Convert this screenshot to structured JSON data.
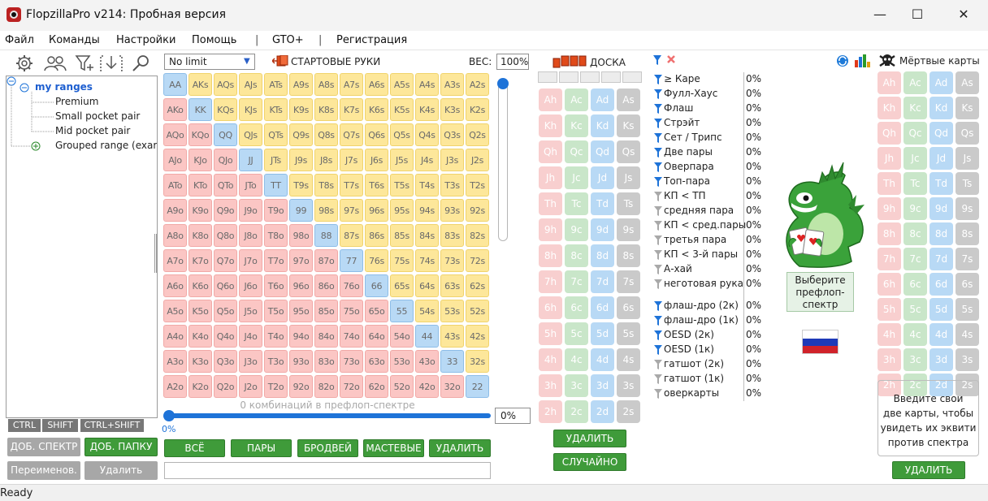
{
  "window": {
    "title": "FlopzillaPro v214: Пробная версия",
    "minimize": "—",
    "maximize": "☐",
    "close": "✕"
  },
  "menu": [
    "Файл",
    "Команды",
    "Настройки",
    "Помощь",
    "|",
    "GTO+",
    "|",
    "Регистрация"
  ],
  "tree": {
    "root": "my ranges",
    "items": [
      "Premium",
      "Small pocket pair",
      "Mid pocket pair"
    ],
    "group": "Grouped range (exar"
  },
  "modifiers": [
    "CTRL",
    "SHIFT",
    "CTRL+SHIFT"
  ],
  "left_buttons": {
    "add_range": "ДОБ. СПЕКТР",
    "add_folder": "ДОБ. ПАПКУ",
    "rename": "Переименов.",
    "delete": "Удалить"
  },
  "range": {
    "game_type": "No limit",
    "title": "СТАРТОВЫЕ РУКИ",
    "weight_label": "ВЕС:",
    "weight": "100%",
    "combos_text": "0 комбинаций в префлоп-спектре",
    "slider_label": "0%",
    "slider_value": "0%",
    "slider_fraction": 0
  },
  "grid": [
    [
      "AA",
      "AKs",
      "AQs",
      "AJs",
      "ATs",
      "A9s",
      "A8s",
      "A7s",
      "A6s",
      "A5s",
      "A4s",
      "A3s",
      "A2s"
    ],
    [
      "AKo",
      "KK",
      "KQs",
      "KJs",
      "KTs",
      "K9s",
      "K8s",
      "K7s",
      "K6s",
      "K5s",
      "K4s",
      "K3s",
      "K2s"
    ],
    [
      "AQo",
      "KQo",
      "QQ",
      "QJs",
      "QTs",
      "Q9s",
      "Q8s",
      "Q7s",
      "Q6s",
      "Q5s",
      "Q4s",
      "Q3s",
      "Q2s"
    ],
    [
      "AJo",
      "KJo",
      "QJo",
      "JJ",
      "JTs",
      "J9s",
      "J8s",
      "J7s",
      "J6s",
      "J5s",
      "J4s",
      "J3s",
      "J2s"
    ],
    [
      "ATo",
      "KTo",
      "QTo",
      "JTo",
      "TT",
      "T9s",
      "T8s",
      "T7s",
      "T6s",
      "T5s",
      "T4s",
      "T3s",
      "T2s"
    ],
    [
      "A9o",
      "K9o",
      "Q9o",
      "J9o",
      "T9o",
      "99",
      "98s",
      "97s",
      "96s",
      "95s",
      "94s",
      "93s",
      "92s"
    ],
    [
      "A8o",
      "K8o",
      "Q8o",
      "J8o",
      "T8o",
      "98o",
      "88",
      "87s",
      "86s",
      "85s",
      "84s",
      "83s",
      "82s"
    ],
    [
      "A7o",
      "K7o",
      "Q7o",
      "J7o",
      "T7o",
      "97o",
      "87o",
      "77",
      "76s",
      "75s",
      "74s",
      "73s",
      "72s"
    ],
    [
      "A6o",
      "K6o",
      "Q6o",
      "J6o",
      "T6o",
      "96o",
      "86o",
      "76o",
      "66",
      "65s",
      "64s",
      "63s",
      "62s"
    ],
    [
      "A5o",
      "K5o",
      "Q5o",
      "J5o",
      "T5o",
      "95o",
      "85o",
      "75o",
      "65o",
      "55",
      "54s",
      "53s",
      "52s"
    ],
    [
      "A4o",
      "K4o",
      "Q4o",
      "J4o",
      "T4o",
      "94o",
      "84o",
      "74o",
      "64o",
      "54o",
      "44",
      "43s",
      "42s"
    ],
    [
      "A3o",
      "K3o",
      "Q3o",
      "J3o",
      "T3o",
      "93o",
      "83o",
      "73o",
      "63o",
      "53o",
      "43o",
      "33",
      "32s"
    ],
    [
      "A2o",
      "K2o",
      "Q2o",
      "J2o",
      "T2o",
      "92o",
      "82o",
      "72o",
      "62o",
      "52o",
      "42o",
      "32o",
      "22"
    ]
  ],
  "range_buttons": {
    "all": "ВСЁ",
    "pairs": "ПАРЫ",
    "broadway": "БРОДВЕЙ",
    "suited": "МАСТЕВЫЕ",
    "delete": "УДАЛИТЬ"
  },
  "board": {
    "title": "ДОСКА",
    "ranks": [
      "A",
      "K",
      "Q",
      "J",
      "T",
      "9",
      "8",
      "7",
      "6",
      "5",
      "4",
      "3",
      "2"
    ],
    "suits": [
      "h",
      "c",
      "d",
      "s"
    ],
    "delete": "УДАЛИТЬ",
    "random": "СЛУЧАЙНО"
  },
  "filters": [
    {
      "label": "≥ Каре",
      "value": "0%",
      "active": true
    },
    {
      "label": "Фулл-Хаус",
      "value": "0%",
      "active": true
    },
    {
      "label": "Флаш",
      "value": "0%",
      "active": true
    },
    {
      "label": "Стрэйт",
      "value": "0%",
      "active": true
    },
    {
      "label": "Сет / Трипс",
      "value": "0%",
      "active": true
    },
    {
      "label": "Две пары",
      "value": "0%",
      "active": true
    },
    {
      "label": "Оверпара",
      "value": "0%",
      "active": true
    },
    {
      "label": "Топ-пара",
      "value": "0%",
      "active": true
    },
    {
      "label": "КП < ТП",
      "value": "0%",
      "active": false
    },
    {
      "label": "средняя пара",
      "value": "0%",
      "active": false
    },
    {
      "label": "КП < сред.пары",
      "value": "0%",
      "active": false
    },
    {
      "label": "третья пара",
      "value": "0%",
      "active": false
    },
    {
      "label": "КП < 3-й пары",
      "value": "0%",
      "active": false
    },
    {
      "label": "А-хай",
      "value": "0%",
      "active": false
    },
    {
      "label": "неготовая рука",
      "value": "0%",
      "active": false
    }
  ],
  "draws": [
    {
      "label": "флаш-дро (2к)",
      "value": "0%",
      "active": true
    },
    {
      "label": "флаш-дро (1к)",
      "value": "0%",
      "active": true
    },
    {
      "label": "OESD (2к)",
      "value": "0%",
      "active": true
    },
    {
      "label": "OESD (1к)",
      "value": "0%",
      "active": true
    },
    {
      "label": "гатшот (2к)",
      "value": "0%",
      "active": false
    },
    {
      "label": "гатшот (1к)",
      "value": "0%",
      "active": false
    },
    {
      "label": "оверкарты",
      "value": "0%",
      "active": false
    }
  ],
  "mascot_prompt": [
    "Выберите",
    "префлоп-",
    "спектр"
  ],
  "dead": {
    "title": "Мёртвые карты",
    "info": [
      "Введите свои",
      "две карты, чтобы",
      "увидеть их эквити",
      "против спектра"
    ],
    "delete": "УДАЛИТЬ"
  },
  "colors": {
    "accent": "#1e73d8",
    "green_button": "#3f9b3a",
    "suited": "#fde79a",
    "offsuit": "#fbc6c4",
    "pair": "#b8d9f5"
  },
  "status": "Ready"
}
